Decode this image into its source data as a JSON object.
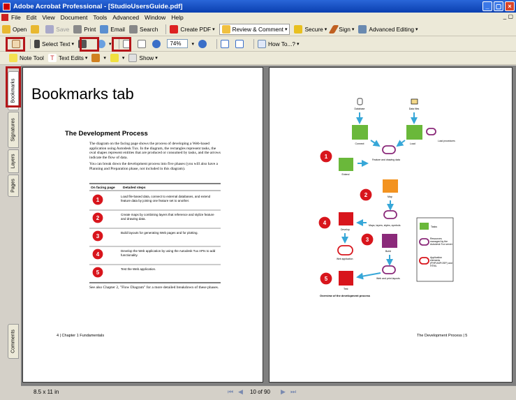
{
  "window": {
    "title": "Adobe Acrobat Professional - [StudioUsersGuide.pdf]"
  },
  "menu": [
    "File",
    "Edit",
    "View",
    "Document",
    "Tools",
    "Advanced",
    "Window",
    "Help"
  ],
  "toolbar1": {
    "open": "Open",
    "save": "Save",
    "print": "Print",
    "email": "Email",
    "search": "Search",
    "create_pdf": "Create PDF",
    "review": "Review & Comment",
    "secure": "Secure",
    "sign": "Sign",
    "advanced_editing": "Advanced Editing"
  },
  "toolbar2": {
    "select_text": "Select Text",
    "zoom": "74%",
    "how_to": "How To...?"
  },
  "toolbar3": {
    "note_tool": "Note Tool",
    "text_edits": "Text Edits",
    "show": "Show"
  },
  "nav_tabs": {
    "bookmarks": "Bookmarks",
    "signatures": "Signatures",
    "layers": "Layers",
    "pages": "Pages",
    "comments": "Comments"
  },
  "callout": "Bookmarks tab",
  "left_page": {
    "heading": "The Development Process",
    "intro1": "The diagram on the facing page shows the process of developing a Web-based application using Autodesk Tux. In the diagram, the rectangles represent tasks, the oval shapes represent entities that are produced or consumed by tasks, and the arrows indicate the flow of data.",
    "intro2": "You can break down the development process into five phases (you will also have a Planning and Preparation phase, not included in this diagram).",
    "col1": "On facing page",
    "col2": "Detailed steps",
    "steps": [
      {
        "n": "1",
        "t": "Load file-based data, connect to external databases, and extend feature data by joining one feature set to another."
      },
      {
        "n": "2",
        "t": "Create maps by combining layers that reference and stylize feature and drawing data."
      },
      {
        "n": "3",
        "t": "Build layouts for generating Web pages and for plotting."
      },
      {
        "n": "4",
        "t": "Develop the Web application by using the Autodesk Tux APIs to add functionality."
      },
      {
        "n": "5",
        "t": "Test the Web application."
      }
    ],
    "see_also": "See also Chapter 2, \"Flow Diagram\" for a more detailed breakdown of these phases.",
    "footer": "4 | Chapter 1 Fundamentals"
  },
  "right_page": {
    "labels": {
      "database": "Database",
      "data_files": "Data files",
      "connect": "Connect",
      "load": "Load",
      "load_procedures": "Load procedures",
      "feature_data": "Feature and drawing data",
      "extend": "Extend",
      "map": "Map",
      "maps_layers": "Maps, layers, styles, symbols",
      "develop": "Develop",
      "build": "Build",
      "web_app": "Web application",
      "web_print": "Web and print layouts",
      "test": "Test"
    },
    "legend": {
      "tasks": "Tasks",
      "resources": "Resources managed by the Autodesk Tux server",
      "app_elements": "Application elements (PHP/ASP/JSP) and HTML"
    },
    "caption": "Overview of the development process",
    "footer": "The Development Process | 5"
  },
  "status": {
    "page_size": "8.5 x 11 in",
    "page_num": "10 of 90"
  },
  "colors": {
    "task_green": "#6ab83a",
    "map_orange": "#f39320",
    "build_purple": "#8b2a7a",
    "test_red": "#d8151c",
    "badge_red": "#d8151c",
    "highlight": "#b5171a"
  }
}
